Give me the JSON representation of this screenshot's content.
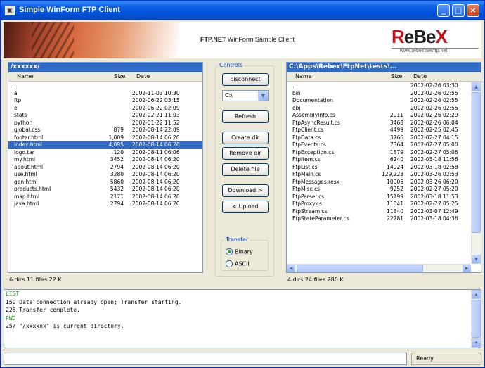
{
  "window": {
    "title": "Simple WinForm FTP Client",
    "buttons": {
      "minimize": "_",
      "maximize": "□",
      "close": "×"
    }
  },
  "banner": {
    "product": "FTP.NET",
    "subtitle": "WinForm Sample Client",
    "logo_parts": [
      "R",
      "e",
      "B",
      "e",
      "X"
    ],
    "logo_url": "www.rebex.net/ftp.net"
  },
  "local": {
    "path": "/xxxxxx/",
    "columns": [
      "Name",
      "Size",
      "Date"
    ],
    "rows": [
      {
        "name": "..",
        "size": "",
        "date": ""
      },
      {
        "name": "a",
        "size": "",
        "date": "2002-11-03 10:30"
      },
      {
        "name": "ftp",
        "size": "",
        "date": "2002-06-22 03:15"
      },
      {
        "name": "e",
        "size": "",
        "date": "2002-06-22 02:09"
      },
      {
        "name": "stats",
        "size": "",
        "date": "2002-02-21 11:03"
      },
      {
        "name": "python",
        "size": "",
        "date": "2002-01-22 11:52"
      },
      {
        "name": "global.css",
        "size": "879",
        "date": "2002-08-14 22:09"
      },
      {
        "name": "footer.html",
        "size": "1,009",
        "date": "2002-08-14 06:20"
      },
      {
        "name": "index.html",
        "size": "4,095",
        "date": "2002-08-14 06:20"
      },
      {
        "name": "logo.tar",
        "size": "120",
        "date": "2002-08-11 06:06"
      },
      {
        "name": "my.html",
        "size": "3452",
        "date": "2002-08-14 06:20"
      },
      {
        "name": "about.html",
        "size": "2794",
        "date": "2002-08-14 06:20"
      },
      {
        "name": "use.html",
        "size": "3280",
        "date": "2002-08-14 06:20"
      },
      {
        "name": "gen.html",
        "size": "5860",
        "date": "2002-08-14 06:20"
      },
      {
        "name": "products.html",
        "size": "5432",
        "date": "2002-08-14 06:20"
      },
      {
        "name": "map.html",
        "size": "2171",
        "date": "2002-08-14 06:20"
      },
      {
        "name": "java.html",
        "size": "2794",
        "date": "2002-08-14 06:20"
      }
    ],
    "selected_index": 8,
    "status": "6 dirs 11 files 22 K"
  },
  "controls": {
    "label": "Controls",
    "disconnect": "disconnect",
    "drive": "C:\\",
    "refresh": "Refresh",
    "create_dir": "Create dir",
    "remove_dir": "Remove dir",
    "delete_file": "Delete file",
    "download": "Download >",
    "upload": "< Upload",
    "transfer_label": "Transfer",
    "binary": "Binary",
    "ascii": "ASCII"
  },
  "remote": {
    "path": "C:\\Apps\\Rebex\\FtpNet\\tests\\...",
    "columns": [
      "Name",
      "Size",
      "Date"
    ],
    "rows": [
      {
        "name": "..",
        "size": "",
        "date": "2002-02-26 03:30"
      },
      {
        "name": "bin",
        "size": "",
        "date": "2002-02-26 02:55"
      },
      {
        "name": "Documentation",
        "size": "",
        "date": "2002-02-26 02:55"
      },
      {
        "name": "obj",
        "size": "",
        "date": "2002-02-26 02:55"
      },
      {
        "name": "AssemblyInfo.cs",
        "size": "2011",
        "date": "2002-02-26 02:29"
      },
      {
        "name": "FtpAsyncResult.cs",
        "size": "3468",
        "date": "2002-02-26 06:04"
      },
      {
        "name": "FtpClient.cs",
        "size": "4499",
        "date": "2002-02-25 02:45"
      },
      {
        "name": "FtpData.cs",
        "size": "3766",
        "date": "2002-02-27 04:15"
      },
      {
        "name": "FtpEvents.cs",
        "size": "7364",
        "date": "2002-02-27 05:00"
      },
      {
        "name": "FtpException.cs",
        "size": "1879",
        "date": "2002-02-27 05:06"
      },
      {
        "name": "FtpItem.cs",
        "size": "6240",
        "date": "2002-03-18 11:56"
      },
      {
        "name": "FtpList.cs",
        "size": "14024",
        "date": "2002-03-18 02:58"
      },
      {
        "name": "FtpMain.cs",
        "size": "129,223",
        "date": "2002-03-26 02:53"
      },
      {
        "name": "FtpMessages.resx",
        "size": "10006",
        "date": "2002-03-26 06:20"
      },
      {
        "name": "FtpMisc.cs",
        "size": "9252",
        "date": "2002-02-27 05:20"
      },
      {
        "name": "FtpParser.cs",
        "size": "15199",
        "date": "2002-03-18 11:53"
      },
      {
        "name": "FtpProxy.cs",
        "size": "11041",
        "date": "2002-02-27 05:25"
      },
      {
        "name": "FtpStream.cs",
        "size": "11340",
        "date": "2002-03-07 12:49"
      },
      {
        "name": "FtpStateParameter.cs",
        "size": "22281",
        "date": "2002-03-18 04:36"
      }
    ],
    "status": "4 dirs 24 files 280 K"
  },
  "log": {
    "lines": [
      {
        "type": "cmd",
        "text": "LIST"
      },
      {
        "type": "resp",
        "text": "150 Data connection already open; Transfer starting."
      },
      {
        "type": "resp",
        "text": "226 Transfer complete."
      },
      {
        "type": "cmd",
        "text": "PWD"
      },
      {
        "type": "resp",
        "text": "257 \"/xxxxxx\" is current directory."
      }
    ]
  },
  "statusbar": {
    "command_value": "",
    "status": "Ready"
  },
  "colors": {
    "titlebar": "#0a5fe4",
    "selection": "#316ac5",
    "log_command": "#118811",
    "logo_red": "#c0141c"
  }
}
